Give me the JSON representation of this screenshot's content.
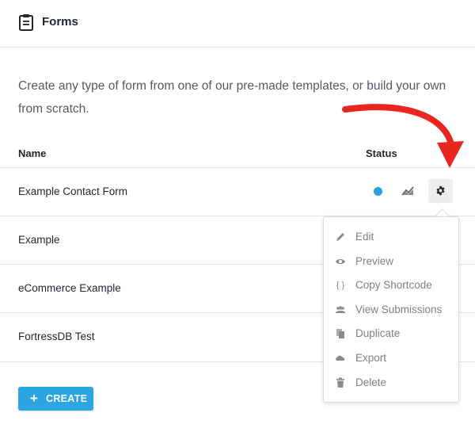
{
  "header": {
    "title": "Forms",
    "icon": "clipboard-icon"
  },
  "intro": "Create any type of form from one of our pre-made templates, or build your own from scratch.",
  "table": {
    "columns": {
      "name": "Name",
      "status": "Status"
    },
    "rows": [
      {
        "name": "Example Contact Form"
      },
      {
        "name": "Example"
      },
      {
        "name": "eCommerce Example"
      },
      {
        "name": "FortressDB Test"
      }
    ]
  },
  "colors": {
    "status_active": "#29a0e0",
    "primary": "#2ba6e1",
    "annotation_arrow": "#e8251f"
  },
  "menu": {
    "items": [
      {
        "label": "Edit",
        "icon": "pencil-icon"
      },
      {
        "label": "Preview",
        "icon": "eye-icon"
      },
      {
        "label": "Copy Shortcode",
        "icon": "braces-icon"
      },
      {
        "label": "View Submissions",
        "icon": "users-icon"
      },
      {
        "label": "Duplicate",
        "icon": "copy-icon"
      },
      {
        "label": "Export",
        "icon": "cloud-export-icon"
      },
      {
        "label": "Delete",
        "icon": "trash-icon"
      }
    ]
  },
  "create_button": {
    "label": "CREATE",
    "icon": "plus-icon"
  }
}
